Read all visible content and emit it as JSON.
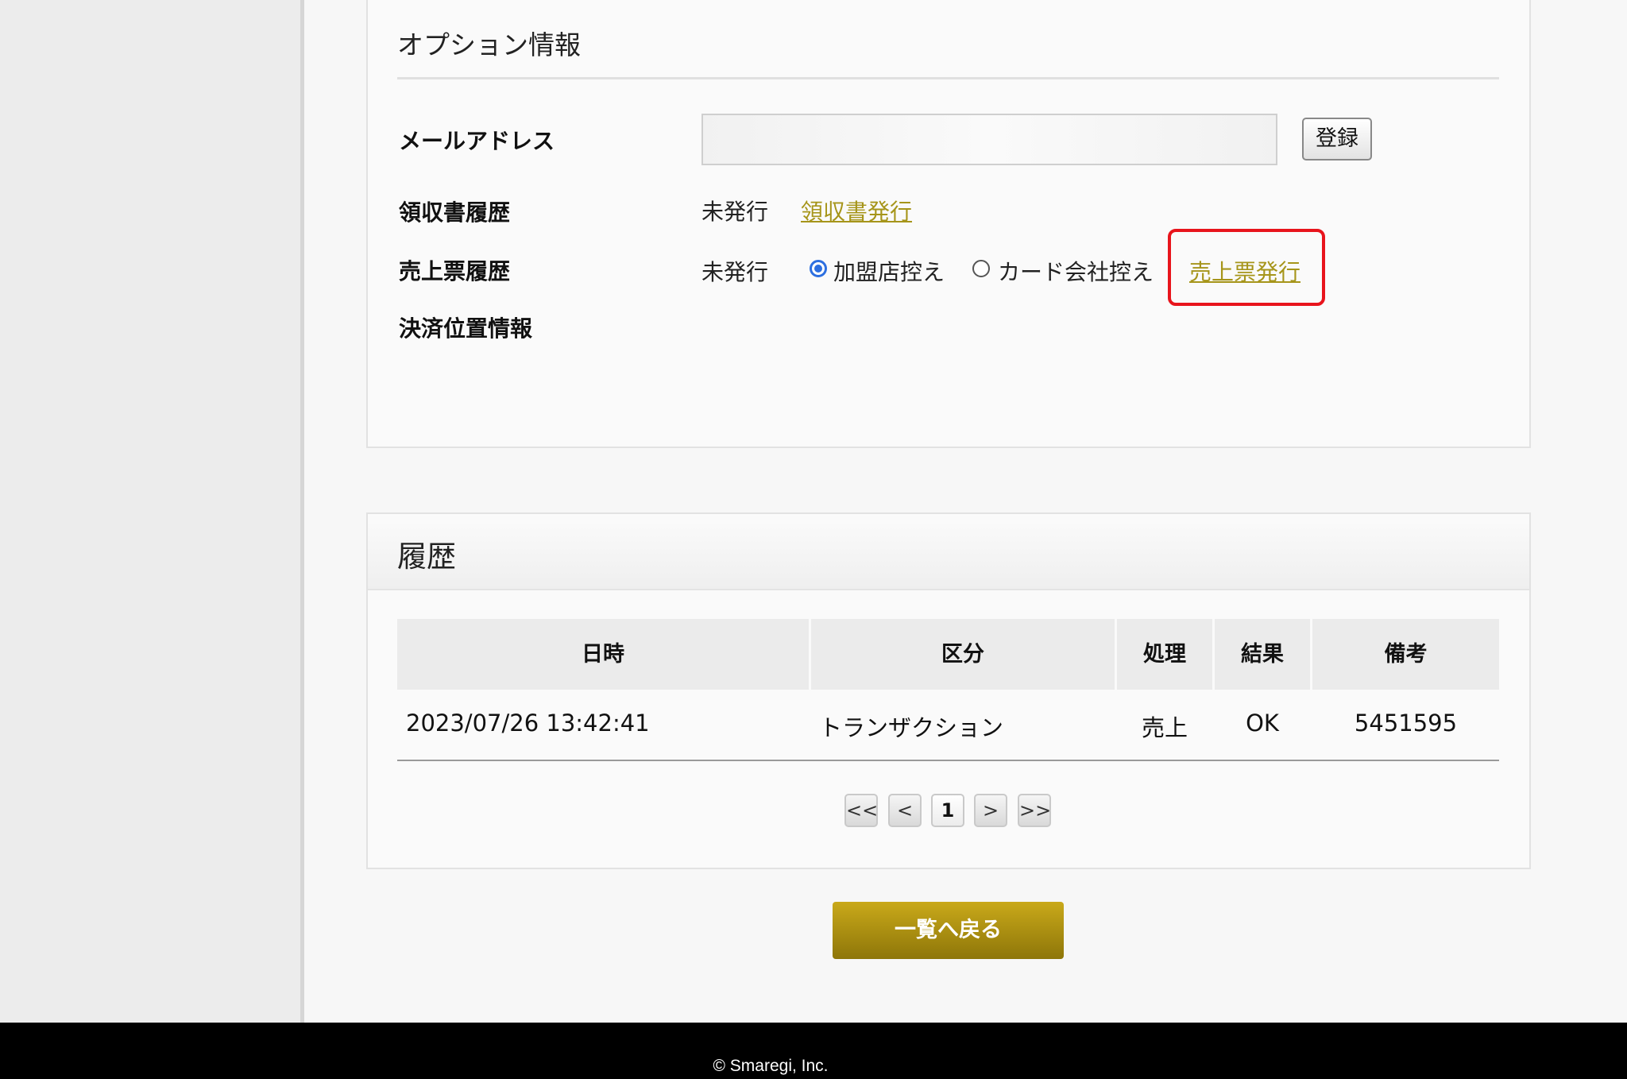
{
  "options_section": {
    "title": "オプション情報",
    "email": {
      "label": "メールアドレス",
      "value": "",
      "placeholder": "",
      "register_label": "登録"
    },
    "receipt_history": {
      "label": "領収書履歴",
      "status": "未発行",
      "issue_link": "領収書発行"
    },
    "sales_slip_history": {
      "label": "売上票履歴",
      "status": "未発行",
      "options": [
        {
          "label": "加盟店控え",
          "selected": true
        },
        {
          "label": "カード会社控え",
          "selected": false
        }
      ],
      "issue_link": "売上票発行"
    },
    "location": {
      "label": "決済位置情報"
    }
  },
  "history_section": {
    "title": "履歴",
    "columns": [
      "日時",
      "区分",
      "処理",
      "結果",
      "備考"
    ],
    "rows": [
      [
        "2023/07/26 13:42:41",
        "トランザクション",
        "売上",
        "OK",
        "5451595"
      ]
    ],
    "pager": {
      "first": "<<",
      "prev": "<",
      "current": "1",
      "next": ">",
      "last": ">>"
    }
  },
  "back_button": "一覧へ戻る",
  "footer": {
    "copyright": "© Smaregi, Inc."
  },
  "colors": {
    "link": "#a6951a",
    "highlight": "#e8141c",
    "radio_accent": "#2d6fe0",
    "back_button": "#b39617"
  }
}
